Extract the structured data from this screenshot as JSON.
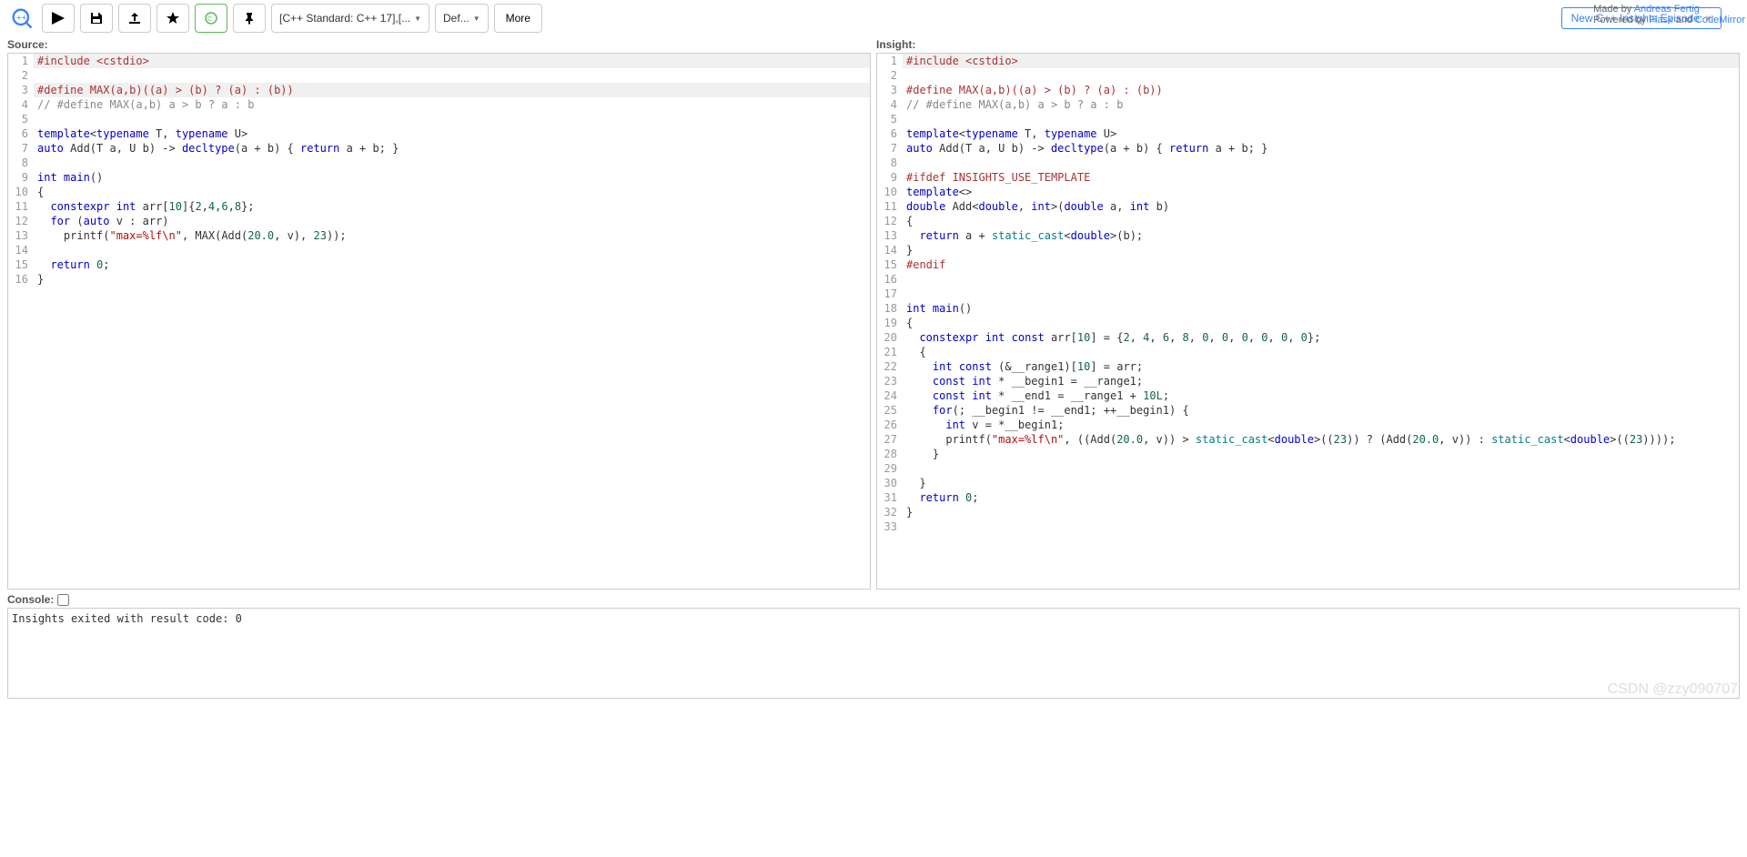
{
  "toolbar": {
    "standard_select": "[C++ Standard: C++ 17],[...",
    "def_select": "Def...",
    "more": "More"
  },
  "banner": {
    "text": "New C++ Insights Episode",
    "close": "×"
  },
  "credits": {
    "line1_prefix": "Made by ",
    "author": "Andreas Fertig",
    "line2_prefix": "Powered by ",
    "flask": "Flask",
    "and": " and ",
    "cm": "CodeMirror"
  },
  "labels": {
    "source": "Source:",
    "insight": "Insight:",
    "console": "Console:"
  },
  "source_lines": [
    {
      "n": 1,
      "hl": true,
      "t": [
        [
          "pp",
          "#include <cstdio>"
        ]
      ]
    },
    {
      "n": 2,
      "t": []
    },
    {
      "n": 3,
      "hl": true,
      "t": [
        [
          "pp",
          "#define MAX(a,b)((a) > (b) ? (a) : (b))"
        ]
      ]
    },
    {
      "n": 4,
      "t": [
        [
          "cm",
          "// #define MAX(a,b) a > b ? a : b"
        ]
      ]
    },
    {
      "n": 5,
      "t": []
    },
    {
      "n": 6,
      "t": [
        [
          "kw",
          "template"
        ],
        [
          "",
          "<"
        ],
        [
          "kw",
          "typename"
        ],
        [
          "",
          " T, "
        ],
        [
          "kw",
          "typename"
        ],
        [
          "",
          " U>"
        ]
      ]
    },
    {
      "n": 7,
      "t": [
        [
          "kw",
          "auto"
        ],
        [
          "",
          " Add(T a, U b) -> "
        ],
        [
          "kw",
          "decltype"
        ],
        [
          "",
          "(a + b) { "
        ],
        [
          "kw",
          "return"
        ],
        [
          "",
          " a + b; }"
        ]
      ]
    },
    {
      "n": 8,
      "t": []
    },
    {
      "n": 9,
      "t": [
        [
          "kw",
          "int"
        ],
        [
          "",
          " "
        ],
        [
          "fn",
          "main"
        ],
        [
          "",
          "()"
        ]
      ]
    },
    {
      "n": 10,
      "t": [
        [
          "",
          "{"
        ]
      ]
    },
    {
      "n": 11,
      "t": [
        [
          "",
          "  "
        ],
        [
          "kw",
          "constexpr"
        ],
        [
          "",
          " "
        ],
        [
          "kw",
          "int"
        ],
        [
          "",
          " arr["
        ],
        [
          "num",
          "10"
        ],
        [
          "",
          "]{"
        ],
        [
          "num",
          "2"
        ],
        [
          "",
          ","
        ],
        [
          "num",
          "4"
        ],
        [
          "",
          ","
        ],
        [
          "num",
          "6"
        ],
        [
          "",
          ","
        ],
        [
          "num",
          "8"
        ],
        [
          "",
          "};"
        ]
      ]
    },
    {
      "n": 12,
      "t": [
        [
          "",
          "  "
        ],
        [
          "kw",
          "for"
        ],
        [
          "",
          " ("
        ],
        [
          "kw",
          "auto"
        ],
        [
          "",
          " v : arr)"
        ]
      ]
    },
    {
      "n": 13,
      "t": [
        [
          "",
          "    printf("
        ],
        [
          "str",
          "\"max=%lf\\n\""
        ],
        [
          "",
          ", MAX(Add("
        ],
        [
          "num",
          "20.0"
        ],
        [
          "",
          ", v), "
        ],
        [
          "num",
          "23"
        ],
        [
          "",
          "));"
        ]
      ]
    },
    {
      "n": 14,
      "t": []
    },
    {
      "n": 15,
      "t": [
        [
          "",
          "  "
        ],
        [
          "kw",
          "return"
        ],
        [
          "",
          " "
        ],
        [
          "num",
          "0"
        ],
        [
          "",
          ";"
        ]
      ]
    },
    {
      "n": 16,
      "t": [
        [
          "",
          "}"
        ]
      ]
    }
  ],
  "insight_lines": [
    {
      "n": 1,
      "hl": true,
      "t": [
        [
          "pp",
          "#include <cstdio>"
        ]
      ]
    },
    {
      "n": 2,
      "t": []
    },
    {
      "n": 3,
      "t": [
        [
          "pp",
          "#define MAX(a,b)((a) > (b) ? (a) : (b))"
        ]
      ]
    },
    {
      "n": 4,
      "t": [
        [
          "cm",
          "// #define MAX(a,b) a > b ? a : b"
        ]
      ]
    },
    {
      "n": 5,
      "t": []
    },
    {
      "n": 6,
      "t": [
        [
          "kw",
          "template"
        ],
        [
          "",
          "<"
        ],
        [
          "kw",
          "typename"
        ],
        [
          "",
          " T, "
        ],
        [
          "kw",
          "typename"
        ],
        [
          "",
          " U>"
        ]
      ]
    },
    {
      "n": 7,
      "t": [
        [
          "kw",
          "auto"
        ],
        [
          "",
          " Add(T a, U b) -> "
        ],
        [
          "kw",
          "decltype"
        ],
        [
          "",
          "(a + b) { "
        ],
        [
          "kw",
          "return"
        ],
        [
          "",
          " a + b; }"
        ]
      ]
    },
    {
      "n": 8,
      "t": []
    },
    {
      "n": 9,
      "t": [
        [
          "pp",
          "#ifdef INSIGHTS_USE_TEMPLATE"
        ]
      ]
    },
    {
      "n": 10,
      "t": [
        [
          "kw",
          "template"
        ],
        [
          "",
          "<>"
        ]
      ]
    },
    {
      "n": 11,
      "t": [
        [
          "kw",
          "double"
        ],
        [
          "",
          " Add<"
        ],
        [
          "kw",
          "double"
        ],
        [
          "",
          ", "
        ],
        [
          "kw",
          "int"
        ],
        [
          "",
          ">("
        ],
        [
          "kw",
          "double"
        ],
        [
          "",
          " a, "
        ],
        [
          "kw",
          "int"
        ],
        [
          "",
          " b)"
        ]
      ]
    },
    {
      "n": 12,
      "t": [
        [
          "",
          "{"
        ]
      ]
    },
    {
      "n": 13,
      "t": [
        [
          "",
          "  "
        ],
        [
          "kw",
          "return"
        ],
        [
          "",
          " a + "
        ],
        [
          "typ",
          "static_cast"
        ],
        [
          "",
          "<"
        ],
        [
          "kw",
          "double"
        ],
        [
          "",
          ">(b);"
        ]
      ]
    },
    {
      "n": 14,
      "t": [
        [
          "",
          "}"
        ]
      ]
    },
    {
      "n": 15,
      "t": [
        [
          "pp",
          "#endif"
        ]
      ]
    },
    {
      "n": 16,
      "t": []
    },
    {
      "n": 17,
      "t": []
    },
    {
      "n": 18,
      "t": [
        [
          "kw",
          "int"
        ],
        [
          "",
          " "
        ],
        [
          "fn",
          "main"
        ],
        [
          "",
          "()"
        ]
      ]
    },
    {
      "n": 19,
      "t": [
        [
          "",
          "{"
        ]
      ]
    },
    {
      "n": 20,
      "t": [
        [
          "",
          "  "
        ],
        [
          "kw",
          "constexpr"
        ],
        [
          "",
          " "
        ],
        [
          "kw",
          "int"
        ],
        [
          "",
          " "
        ],
        [
          "kw",
          "const"
        ],
        [
          "",
          " arr["
        ],
        [
          "num",
          "10"
        ],
        [
          "",
          "] = {"
        ],
        [
          "num",
          "2"
        ],
        [
          "",
          ", "
        ],
        [
          "num",
          "4"
        ],
        [
          "",
          ", "
        ],
        [
          "num",
          "6"
        ],
        [
          "",
          ", "
        ],
        [
          "num",
          "8"
        ],
        [
          "",
          ", "
        ],
        [
          "num",
          "0"
        ],
        [
          "",
          ", "
        ],
        [
          "num",
          "0"
        ],
        [
          "",
          ", "
        ],
        [
          "num",
          "0"
        ],
        [
          "",
          ", "
        ],
        [
          "num",
          "0"
        ],
        [
          "",
          ", "
        ],
        [
          "num",
          "0"
        ],
        [
          "",
          ", "
        ],
        [
          "num",
          "0"
        ],
        [
          "",
          "};"
        ]
      ]
    },
    {
      "n": 21,
      "t": [
        [
          "",
          "  {"
        ]
      ]
    },
    {
      "n": 22,
      "t": [
        [
          "",
          "    "
        ],
        [
          "kw",
          "int"
        ],
        [
          "",
          " "
        ],
        [
          "kw",
          "const"
        ],
        [
          "",
          " (&__range1)["
        ],
        [
          "num",
          "10"
        ],
        [
          "",
          "] = arr;"
        ]
      ]
    },
    {
      "n": 23,
      "t": [
        [
          "",
          "    "
        ],
        [
          "kw",
          "const"
        ],
        [
          "",
          " "
        ],
        [
          "kw",
          "int"
        ],
        [
          "",
          " * __begin1 = __range1;"
        ]
      ]
    },
    {
      "n": 24,
      "t": [
        [
          "",
          "    "
        ],
        [
          "kw",
          "const"
        ],
        [
          "",
          " "
        ],
        [
          "kw",
          "int"
        ],
        [
          "",
          " * __end1 = __range1 + "
        ],
        [
          "num",
          "10L"
        ],
        [
          "",
          ";"
        ]
      ]
    },
    {
      "n": 25,
      "t": [
        [
          "",
          "    "
        ],
        [
          "kw",
          "for"
        ],
        [
          "",
          "(; __begin1 != __end1; ++__begin1) {"
        ]
      ]
    },
    {
      "n": 26,
      "t": [
        [
          "",
          "      "
        ],
        [
          "kw",
          "int"
        ],
        [
          "",
          " v = *__begin1;"
        ]
      ]
    },
    {
      "n": 27,
      "t": [
        [
          "",
          "      printf("
        ],
        [
          "str",
          "\"max=%lf\\n\""
        ],
        [
          "",
          ", ((Add("
        ],
        [
          "num",
          "20.0"
        ],
        [
          "",
          ", v)) > "
        ],
        [
          "typ",
          "static_cast"
        ],
        [
          "",
          "<"
        ],
        [
          "kw",
          "double"
        ],
        [
          "",
          ">(("
        ],
        [
          "num",
          "23"
        ],
        [
          "",
          ")) ? (Add("
        ],
        [
          "num",
          "20.0"
        ],
        [
          "",
          ", v)) : "
        ],
        [
          "typ",
          "static_cast"
        ],
        [
          "",
          "<"
        ],
        [
          "kw",
          "double"
        ],
        [
          "",
          ">(("
        ],
        [
          "num",
          "23"
        ],
        [
          "",
          "))));"
        ]
      ]
    },
    {
      "n": 28,
      "t": [
        [
          "",
          "    }"
        ]
      ]
    },
    {
      "n": 29,
      "t": []
    },
    {
      "n": 30,
      "t": [
        [
          "",
          "  }"
        ]
      ]
    },
    {
      "n": 31,
      "t": [
        [
          "",
          "  "
        ],
        [
          "kw",
          "return"
        ],
        [
          "",
          " "
        ],
        [
          "num",
          "0"
        ],
        [
          "",
          ";"
        ]
      ]
    },
    {
      "n": 32,
      "t": [
        [
          "",
          "}"
        ]
      ]
    },
    {
      "n": 33,
      "t": []
    }
  ],
  "console_output": "Insights exited with result code: 0",
  "watermark": "CSDN @zzy090707"
}
